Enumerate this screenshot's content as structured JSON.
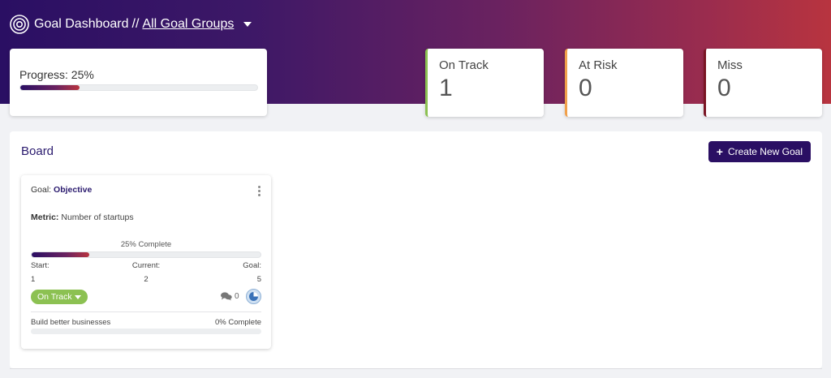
{
  "header": {
    "title": "Goal Dashboard",
    "separator": "//",
    "group_selector": "All Goal Groups"
  },
  "progress": {
    "label": "Progress: 25%",
    "value_percent": 25
  },
  "stats": [
    {
      "title": "On Track",
      "value": "1",
      "color": "#8cc152"
    },
    {
      "title": "At Risk",
      "value": "0",
      "color": "#f0a04b"
    },
    {
      "title": "Miss",
      "value": "0",
      "color": "#7a1524"
    }
  ],
  "board": {
    "title": "Board",
    "create_button": "Create New Goal"
  },
  "goal_card": {
    "goal_prefix": "Goal:",
    "goal_name": "Objective",
    "metric_prefix": "Metric:",
    "metric_name": "Number of startups",
    "complete_text": "25% Complete",
    "progress_percent": 25,
    "start_label": "Start:",
    "current_label": "Current:",
    "goal_label": "Goal:",
    "start_value": "1",
    "current_value": "2",
    "goal_value": "5",
    "status": "On Track",
    "comment_count": "0",
    "sub_goal": {
      "name": "Build better businesses",
      "complete_text": "0% Complete",
      "progress_percent": 0
    }
  },
  "colors": {
    "brand_dark": "#2a0f63",
    "brand_red": "#b8343f",
    "on_track": "#8cc152"
  }
}
